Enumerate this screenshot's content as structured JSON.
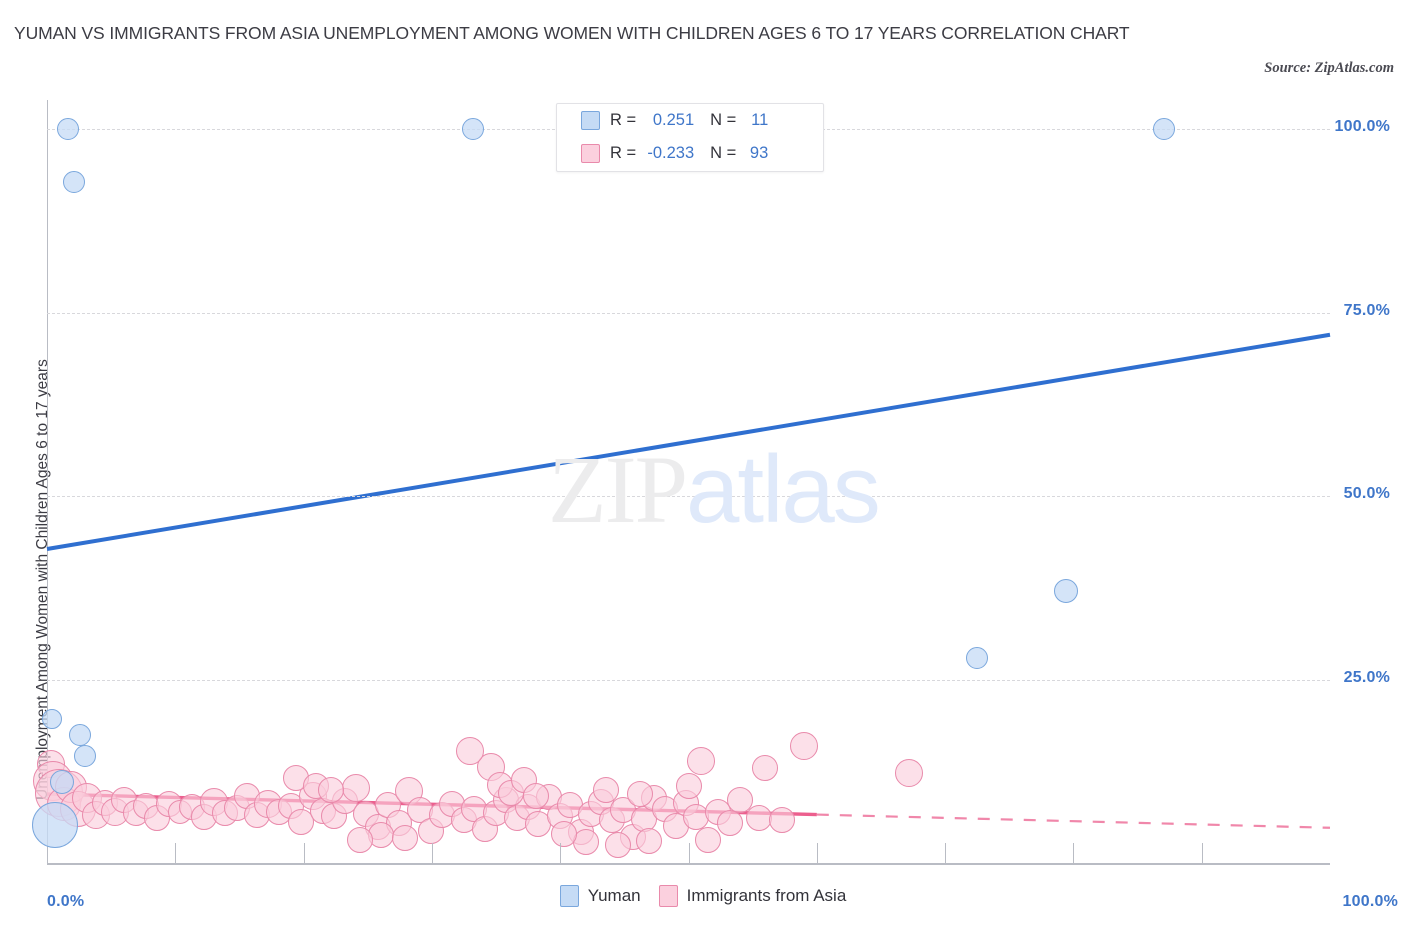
{
  "header": {
    "title": "YUMAN VS IMMIGRANTS FROM ASIA UNEMPLOYMENT AMONG WOMEN WITH CHILDREN AGES 6 TO 17 YEARS CORRELATION CHART",
    "source": "Source: ZipAtlas.com"
  },
  "watermark": {
    "part1": "ZIP",
    "part2": "atlas"
  },
  "stats": {
    "rows": [
      {
        "color": "#c5dbf5",
        "r_label": "R =",
        "r_value": "0.251",
        "n_label": "N =",
        "n_value": "11"
      },
      {
        "color": "#fbd0de",
        "r_label": "R =",
        "r_value": "-0.233",
        "n_label": "N =",
        "n_value": "93"
      }
    ]
  },
  "legend": {
    "items": [
      {
        "label": "Yuman",
        "color": "#c5dbf5"
      },
      {
        "label": "Immigrants from Asia",
        "color": "#fbd0de"
      }
    ]
  },
  "chart_data": {
    "type": "scatter",
    "title": "YUMAN VS IMMIGRANTS FROM ASIA UNEMPLOYMENT AMONG WOMEN WITH CHILDREN AGES 6 TO 17 YEARS CORRELATION CHART",
    "xlabel": "",
    "ylabel": "Unemployment Among Women with Children Ages 6 to 17 years",
    "xlim": [
      0,
      100
    ],
    "ylim": [
      0,
      104
    ],
    "grid": true,
    "legend_position": "bottom-center",
    "x_tick_labels": [
      "0.0%",
      "100.0%"
    ],
    "y_tick_labels": [
      "25.0%",
      "50.0%",
      "75.0%",
      "100.0%"
    ],
    "y_ticks": [
      25,
      50,
      75,
      100
    ],
    "x_ticks": [
      0,
      10,
      20,
      30,
      40,
      50,
      60,
      70,
      80,
      90,
      100
    ],
    "series": [
      {
        "name": "Yuman",
        "color": "#c5dbf5",
        "edge_color": "#7aa7dd",
        "r": 0.251,
        "n": 11,
        "trendline": {
          "x0": 0,
          "y0": 42.8,
          "x1": 100,
          "y1": 72.0,
          "style": "solid",
          "color": "#2f6fd0"
        },
        "points": [
          {
            "x": 1.6,
            "y": 100.0,
            "r": 11
          },
          {
            "x": 2.1,
            "y": 92.8,
            "r": 11
          },
          {
            "x": 33.2,
            "y": 100.0,
            "r": 11
          },
          {
            "x": 87.1,
            "y": 100.0,
            "r": 11
          },
          {
            "x": 79.4,
            "y": 37.1,
            "r": 12
          },
          {
            "x": 72.5,
            "y": 28.0,
            "r": 11
          },
          {
            "x": 0.4,
            "y": 19.6,
            "r": 10
          },
          {
            "x": 2.6,
            "y": 17.5,
            "r": 11
          },
          {
            "x": 3.0,
            "y": 14.6,
            "r": 11
          },
          {
            "x": 1.2,
            "y": 11.1,
            "r": 12
          },
          {
            "x": 0.6,
            "y": 5.2,
            "r": 23
          }
        ]
      },
      {
        "name": "Immigrants from Asia",
        "color": "#fbd0de",
        "edge_color": "#e98aab",
        "r": -0.233,
        "n": 93,
        "trendline": {
          "x0": 0,
          "y0": 9.4,
          "x1": 60,
          "y1": 6.6,
          "style": "solid",
          "color": "#ec5f8e",
          "dash_x0": 60,
          "dash_y0": 6.6,
          "dash_x1": 100,
          "dash_y1": 4.8
        },
        "points": [
          {
            "x": 0.3,
            "y": 13.5,
            "r": 14
          },
          {
            "x": 0.5,
            "y": 11.2,
            "r": 20
          },
          {
            "x": 0.9,
            "y": 9.5,
            "r": 24
          },
          {
            "x": 1.3,
            "y": 8.0,
            "r": 17
          },
          {
            "x": 1.9,
            "y": 10.4,
            "r": 16
          },
          {
            "x": 2.4,
            "y": 7.4,
            "r": 18
          },
          {
            "x": 3.1,
            "y": 8.8,
            "r": 15
          },
          {
            "x": 3.8,
            "y": 6.5,
            "r": 14
          },
          {
            "x": 4.5,
            "y": 8.2,
            "r": 13
          },
          {
            "x": 5.3,
            "y": 7.0,
            "r": 14
          },
          {
            "x": 6.0,
            "y": 8.6,
            "r": 13
          },
          {
            "x": 6.9,
            "y": 6.8,
            "r": 13
          },
          {
            "x": 7.7,
            "y": 7.8,
            "r": 13
          },
          {
            "x": 8.6,
            "y": 6.2,
            "r": 13
          },
          {
            "x": 9.5,
            "y": 8.0,
            "r": 13
          },
          {
            "x": 10.4,
            "y": 6.9,
            "r": 12
          },
          {
            "x": 11.3,
            "y": 7.6,
            "r": 13
          },
          {
            "x": 12.2,
            "y": 6.3,
            "r": 13
          },
          {
            "x": 13.0,
            "y": 8.3,
            "r": 14
          },
          {
            "x": 13.9,
            "y": 6.8,
            "r": 13
          },
          {
            "x": 14.8,
            "y": 7.5,
            "r": 13
          },
          {
            "x": 15.6,
            "y": 9.1,
            "r": 13
          },
          {
            "x": 16.4,
            "y": 6.6,
            "r": 13
          },
          {
            "x": 17.2,
            "y": 8.0,
            "r": 14
          },
          {
            "x": 18.1,
            "y": 6.9,
            "r": 13
          },
          {
            "x": 19.0,
            "y": 7.8,
            "r": 13
          },
          {
            "x": 19.8,
            "y": 5.6,
            "r": 13
          },
          {
            "x": 20.7,
            "y": 9.2,
            "r": 14
          },
          {
            "x": 21.5,
            "y": 7.1,
            "r": 13
          },
          {
            "x": 22.4,
            "y": 6.4,
            "r": 13
          },
          {
            "x": 23.2,
            "y": 8.4,
            "r": 13
          },
          {
            "x": 24.1,
            "y": 10.2,
            "r": 14
          },
          {
            "x": 24.9,
            "y": 6.7,
            "r": 13
          },
          {
            "x": 25.8,
            "y": 4.9,
            "r": 13
          },
          {
            "x": 26.6,
            "y": 7.9,
            "r": 13
          },
          {
            "x": 27.4,
            "y": 5.5,
            "r": 13
          },
          {
            "x": 28.2,
            "y": 9.8,
            "r": 14
          },
          {
            "x": 29.1,
            "y": 7.2,
            "r": 13
          },
          {
            "x": 29.9,
            "y": 4.4,
            "r": 13
          },
          {
            "x": 30.8,
            "y": 6.5,
            "r": 13
          },
          {
            "x": 31.6,
            "y": 8.1,
            "r": 13
          },
          {
            "x": 32.5,
            "y": 5.9,
            "r": 13
          },
          {
            "x": 33.3,
            "y": 7.3,
            "r": 13
          },
          {
            "x": 34.1,
            "y": 4.7,
            "r": 13
          },
          {
            "x": 35.0,
            "y": 6.8,
            "r": 13
          },
          {
            "x": 35.8,
            "y": 8.6,
            "r": 13
          },
          {
            "x": 36.6,
            "y": 6.1,
            "r": 13
          },
          {
            "x": 37.5,
            "y": 7.7,
            "r": 13
          },
          {
            "x": 38.3,
            "y": 5.3,
            "r": 13
          },
          {
            "x": 39.1,
            "y": 9.0,
            "r": 13
          },
          {
            "x": 40.0,
            "y": 6.4,
            "r": 13
          },
          {
            "x": 40.8,
            "y": 7.9,
            "r": 13
          },
          {
            "x": 41.6,
            "y": 4.2,
            "r": 13
          },
          {
            "x": 42.4,
            "y": 6.7,
            "r": 13
          },
          {
            "x": 43.2,
            "y": 8.3,
            "r": 13
          },
          {
            "x": 44.0,
            "y": 5.8,
            "r": 13
          },
          {
            "x": 44.9,
            "y": 7.2,
            "r": 13
          },
          {
            "x": 45.7,
            "y": 3.5,
            "r": 13
          },
          {
            "x": 46.5,
            "y": 6.0,
            "r": 13
          },
          {
            "x": 47.3,
            "y": 8.8,
            "r": 13
          },
          {
            "x": 34.6,
            "y": 13.1,
            "r": 14
          },
          {
            "x": 35.3,
            "y": 10.6,
            "r": 13
          },
          {
            "x": 36.2,
            "y": 9.6,
            "r": 13
          },
          {
            "x": 37.2,
            "y": 11.3,
            "r": 13
          },
          {
            "x": 38.1,
            "y": 9.2,
            "r": 13
          },
          {
            "x": 33.0,
            "y": 15.2,
            "r": 14
          },
          {
            "x": 19.4,
            "y": 11.6,
            "r": 13
          },
          {
            "x": 21.0,
            "y": 10.5,
            "r": 13
          },
          {
            "x": 22.1,
            "y": 9.9,
            "r": 13
          },
          {
            "x": 48.2,
            "y": 7.4,
            "r": 13
          },
          {
            "x": 49.0,
            "y": 5.1,
            "r": 13
          },
          {
            "x": 49.8,
            "y": 8.2,
            "r": 13
          },
          {
            "x": 50.6,
            "y": 6.3,
            "r": 13
          },
          {
            "x": 51.5,
            "y": 3.2,
            "r": 13
          },
          {
            "x": 52.3,
            "y": 7.0,
            "r": 13
          },
          {
            "x": 53.2,
            "y": 5.5,
            "r": 13
          },
          {
            "x": 54.0,
            "y": 8.6,
            "r": 13
          },
          {
            "x": 42.0,
            "y": 2.8,
            "r": 13
          },
          {
            "x": 44.5,
            "y": 2.4,
            "r": 13
          },
          {
            "x": 46.9,
            "y": 3.0,
            "r": 13
          },
          {
            "x": 40.3,
            "y": 3.9,
            "r": 13
          },
          {
            "x": 43.6,
            "y": 10.0,
            "r": 13
          },
          {
            "x": 46.2,
            "y": 9.4,
            "r": 13
          },
          {
            "x": 26.0,
            "y": 3.8,
            "r": 13
          },
          {
            "x": 27.9,
            "y": 3.4,
            "r": 13
          },
          {
            "x": 24.4,
            "y": 3.1,
            "r": 13
          },
          {
            "x": 50.0,
            "y": 10.5,
            "r": 13
          },
          {
            "x": 55.5,
            "y": 6.2,
            "r": 13
          },
          {
            "x": 57.3,
            "y": 5.8,
            "r": 13
          },
          {
            "x": 51.0,
            "y": 13.9,
            "r": 14
          },
          {
            "x": 56.0,
            "y": 12.9,
            "r": 13
          },
          {
            "x": 59.0,
            "y": 16.0,
            "r": 14
          },
          {
            "x": 67.2,
            "y": 12.2,
            "r": 14
          }
        ]
      }
    ]
  }
}
